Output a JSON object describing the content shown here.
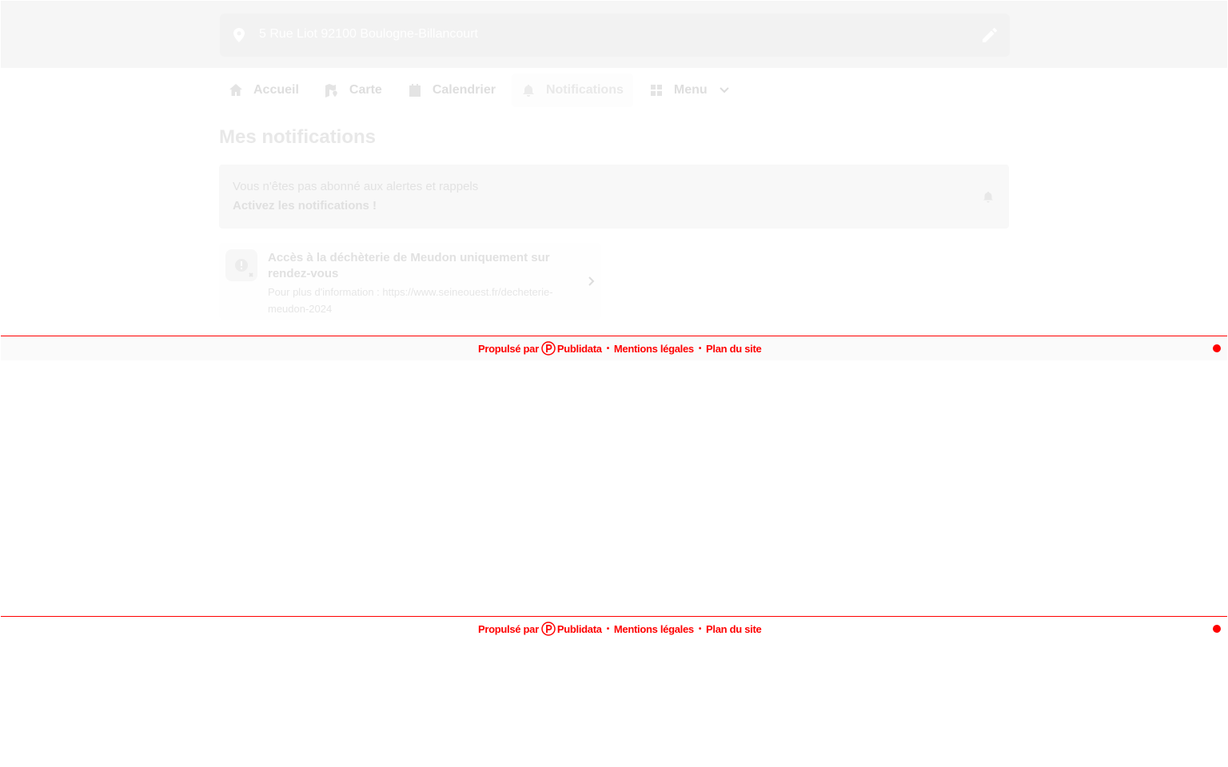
{
  "header": {
    "address": "5 Rue Liot 92100 Boulogne-Billancourt"
  },
  "nav": {
    "items": [
      {
        "label": "Accueil",
        "icon": "home-icon"
      },
      {
        "label": "Carte",
        "icon": "map-icon"
      },
      {
        "label": "Calendrier",
        "icon": "calendar-icon"
      },
      {
        "label": "Notifications",
        "icon": "bell-icon",
        "active": true
      },
      {
        "label": "Menu",
        "icon": "grid-icon"
      }
    ]
  },
  "main": {
    "title": "Mes notifications",
    "subscribe": {
      "line1": "Vous n'êtes pas abonné aux alertes et rappels",
      "line2": "Activez les notifications !"
    },
    "notifications": [
      {
        "title": "Accès à la déchèterie de Meudon uniquement sur rendez-vous",
        "body": "Pour plus d'information : https://www.seineouest.fr/decheterie-meudon-2024"
      }
    ]
  },
  "footer": {
    "powered_by": "Propulsé par",
    "brand": "Publidata",
    "legal": "Mentions légales",
    "sitemap": "Plan du site",
    "separator": "•",
    "accent_color": "#ff0000"
  }
}
